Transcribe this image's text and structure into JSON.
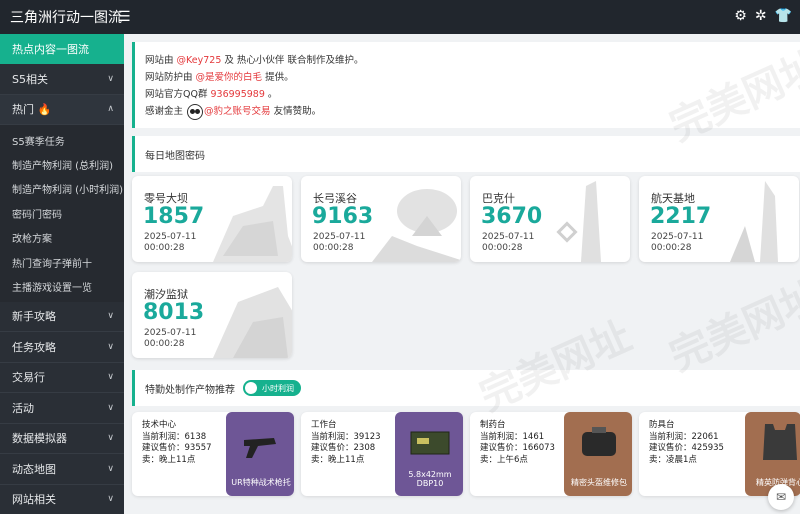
{
  "topbar": {
    "title": "三角洲行动一图流",
    "menu_icon": "menu-icon",
    "icons": [
      "settings-icon",
      "gear-icon",
      "shirt-icon"
    ]
  },
  "sidebar": {
    "active": "热点内容一图流",
    "items_top": [
      {
        "label": "S5相关",
        "chevron": "∨"
      },
      {
        "label": "热门 🔥",
        "chevron": "∧"
      }
    ],
    "sub_items": [
      "S5赛季任务",
      "制造产物利润 (总利润)",
      "制造产物利润 (小时利润)",
      "密码门密码",
      "改枪方案",
      "热门查询子弹前十",
      "主播游戏设置一览"
    ],
    "items_bottom": [
      "新手攻略",
      "任务攻略",
      "交易行",
      "活动",
      "数据模拟器",
      "动态地图",
      "网站相关"
    ],
    "chevron": "∨"
  },
  "notice": {
    "line1_a": "网站由 ",
    "line1_b": "@Key725",
    "line1_c": " 及 热心小伙伴 联合制作及维护。",
    "line2_a": "网站防护由 ",
    "line2_b": "@是爱你的白毛",
    "line2_c": " 提供。",
    "line3_a": "网站官方QQ群 ",
    "line3_b": "936995989",
    "line3_c": " 。",
    "line4_a": "感谢金主 ",
    "line4_b": "@豹之账号交易",
    "line4_c": " 友情赞助。"
  },
  "daily": {
    "title": "每日地图密码",
    "maps": [
      {
        "name": "零号大坝",
        "code": "1857",
        "date": "2025-07-11",
        "time": "00:00:28"
      },
      {
        "name": "长弓溪谷",
        "code": "9163",
        "date": "2025-07-11",
        "time": "00:00:28"
      },
      {
        "name": "巴克什",
        "code": "3670",
        "date": "2025-07-11",
        "time": "00:00:28"
      },
      {
        "name": "航天基地",
        "code": "2217",
        "date": "2025-07-11",
        "time": "00:00:28"
      },
      {
        "name": "潮汐监狱",
        "code": "8013",
        "date": "2025-07-11",
        "time": "00:00:28"
      }
    ]
  },
  "crafting": {
    "title": "特勤处制作产物推荐",
    "toggle_label": "小时利润",
    "items": [
      {
        "station": "技术中心",
        "profit": "当前利润：6138",
        "price": "建议售价：93557",
        "sell": "卖：晚上11点",
        "product": "UR特种战术枪托",
        "color": "#6e5696"
      },
      {
        "station": "工作台",
        "profit": "当前利润：39123",
        "price": "建议售价：2308",
        "sell": "卖：晚上11点",
        "product": "5.8x42mm DBP10",
        "color": "#6e5696"
      },
      {
        "station": "制药台",
        "profit": "当前利润：1461",
        "price": "建议售价：166073",
        "sell": "卖：上午6点",
        "product": "精密头盔维修包",
        "color": "#a26e50"
      },
      {
        "station": "防具台",
        "profit": "当前利润：22061",
        "price": "建议售价：425935",
        "sell": "卖：凌晨1点",
        "product": "精英防弹背心",
        "color": "#a26e50"
      }
    ]
  },
  "watermark": "完美网址",
  "float_button_icon": "chat-icon"
}
